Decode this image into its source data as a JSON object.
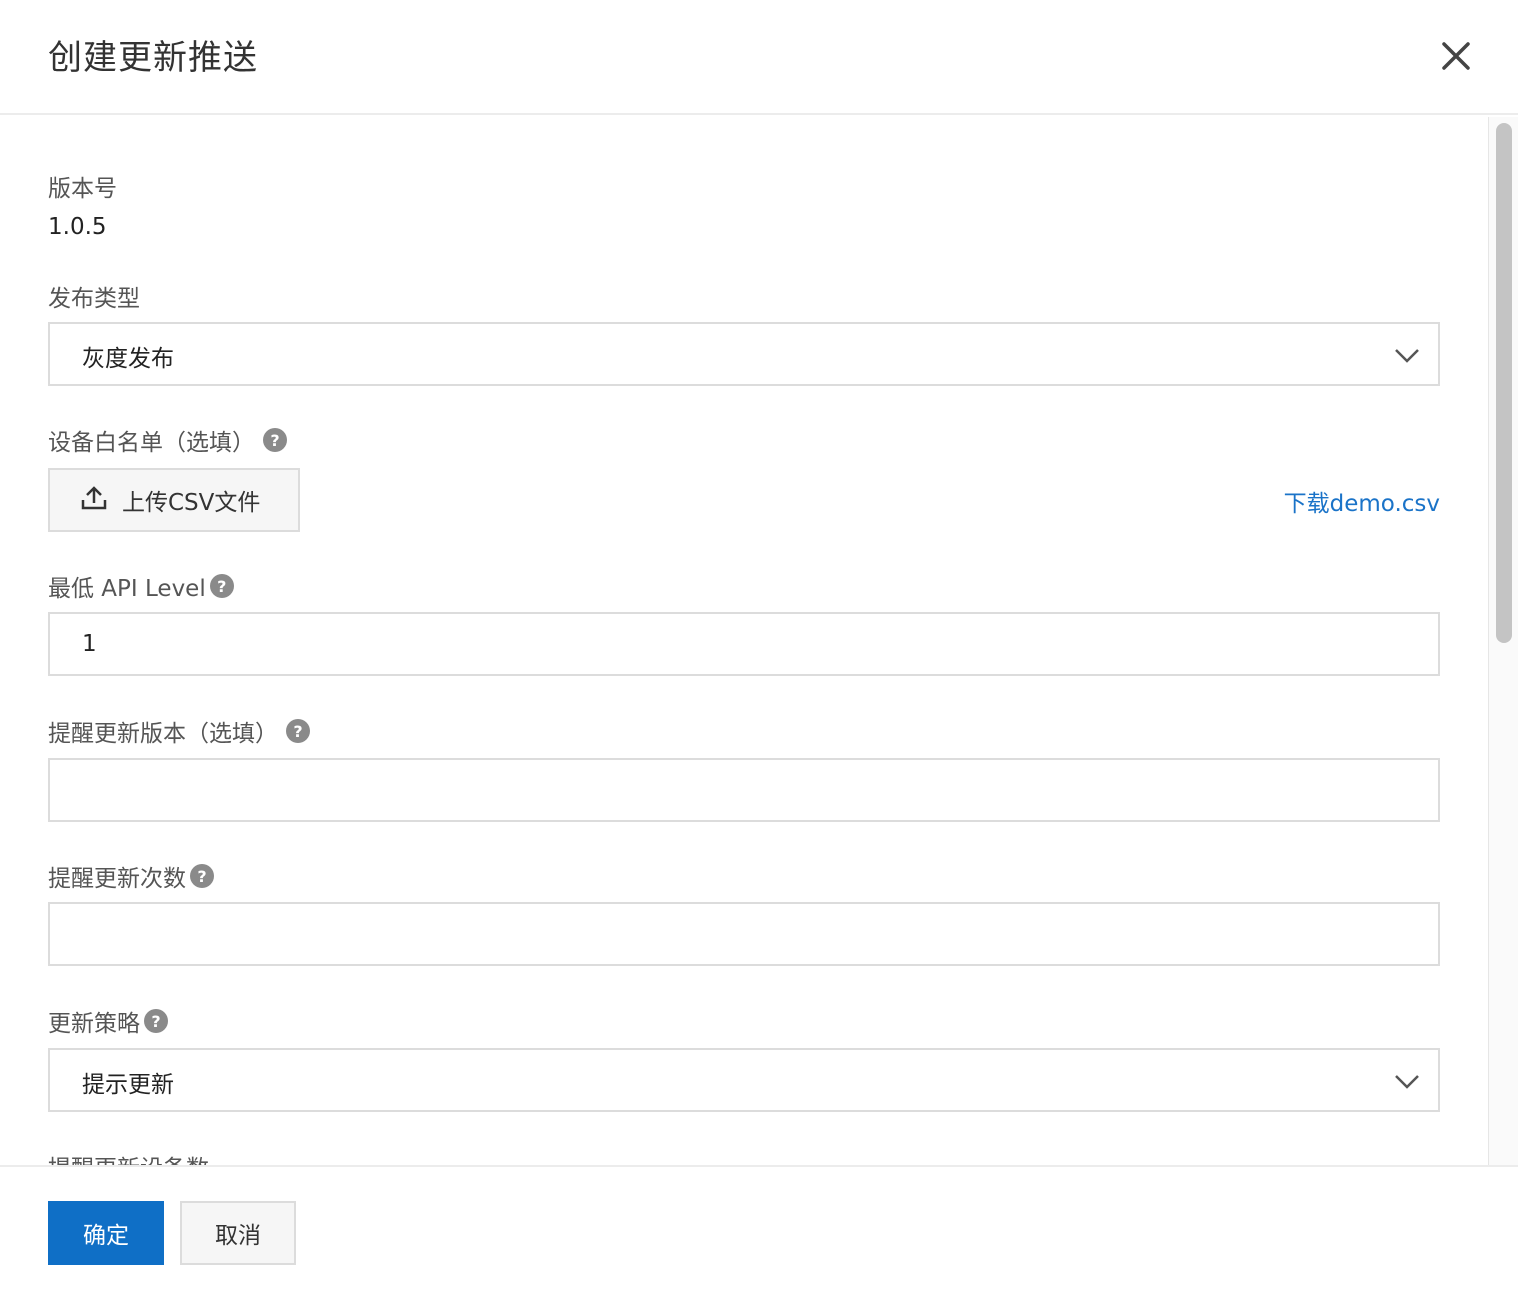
{
  "dialog": {
    "title": "创建更新推送"
  },
  "version": {
    "label": "版本号",
    "value": "1.0.5"
  },
  "release_type": {
    "label": "发布类型",
    "selected": "灰度发布"
  },
  "whitelist": {
    "label": "设备白名单（选填）",
    "upload_label": "上传CSV文件",
    "download_link": "下载demo.csv"
  },
  "min_api": {
    "label": "最低 API Level",
    "value": "1"
  },
  "remind_version": {
    "label": "提醒更新版本（选填）",
    "value": ""
  },
  "remind_count": {
    "label": "提醒更新次数",
    "value": ""
  },
  "strategy": {
    "label": "更新策略",
    "selected": "提示更新"
  },
  "remind_devices": {
    "label": "提醒更新设备数"
  },
  "footer": {
    "ok_label": "确定",
    "cancel_label": "取消"
  },
  "icons": {
    "help": "?"
  },
  "colors": {
    "primary": "#0f6fc6",
    "link": "#1a73c8"
  }
}
